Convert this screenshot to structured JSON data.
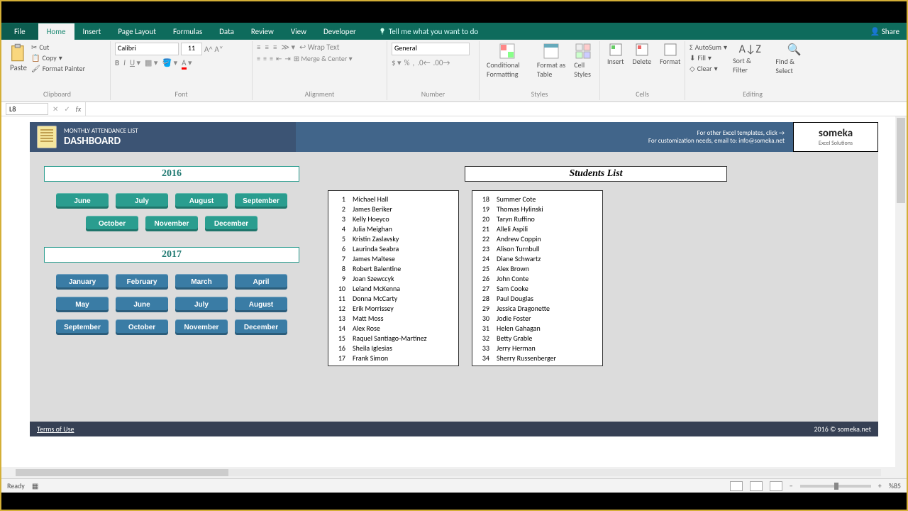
{
  "tabs": {
    "file": "File",
    "home": "Home",
    "insert": "Insert",
    "pagelayout": "Page Layout",
    "formulas": "Formulas",
    "data": "Data",
    "review": "Review",
    "view": "View",
    "developer": "Developer"
  },
  "tell": "Tell me what you want to do",
  "share": "Share",
  "ribbon": {
    "paste": "Paste",
    "cut": "Cut",
    "copy": "Copy",
    "format_painter": "Format Painter",
    "clipboard": "Clipboard",
    "font_name": "Calibri",
    "font_size": "11",
    "font": "Font",
    "wrap": "Wrap Text",
    "merge": "Merge & Center",
    "alignment": "Alignment",
    "num_format": "General",
    "number": "Number",
    "cond_fmt": "Conditional Formatting",
    "fmt_table": "Format as Table",
    "cell_styles": "Cell Styles",
    "styles": "Styles",
    "insert": "Insert",
    "delete": "Delete",
    "format": "Format",
    "cells": "Cells",
    "autosum": "AutoSum",
    "fill": "Fill",
    "clear": "Clear",
    "sort": "Sort & Filter",
    "find": "Find & Select",
    "editing": "Editing"
  },
  "namebox": "L8",
  "dashboard": {
    "title_small": "MONTHLY ATTENDANCE LIST",
    "title_big": "DASHBOARD",
    "banner1": "For other Excel templates, click →",
    "banner2": "For customization needs, email to: info@someka.net",
    "logo": "someka",
    "logo_sub": "Excel Solutions",
    "year1": "2016",
    "months1": [
      "June",
      "July",
      "August",
      "September",
      "October",
      "November",
      "December"
    ],
    "year2": "2017",
    "months2": [
      "January",
      "February",
      "March",
      "April",
      "May",
      "June",
      "July",
      "August",
      "September",
      "October",
      "November",
      "December"
    ],
    "students_label": "Students List",
    "students_col1": [
      {
        "n": "1",
        "name": "Michael Hall"
      },
      {
        "n": "2",
        "name": "James Beriker"
      },
      {
        "n": "3",
        "name": "Kelly Hoeyco"
      },
      {
        "n": "4",
        "name": "Julia Meighan"
      },
      {
        "n": "5",
        "name": "Kristin Zaslavsky"
      },
      {
        "n": "6",
        "name": "Laurinda Seabra"
      },
      {
        "n": "7",
        "name": "James Maltese"
      },
      {
        "n": "8",
        "name": "Robert Balentine"
      },
      {
        "n": "9",
        "name": "Joan Szewccyk"
      },
      {
        "n": "10",
        "name": "Leland McKenna"
      },
      {
        "n": "11",
        "name": "Donna McCarty"
      },
      {
        "n": "12",
        "name": "Erik Morrissey"
      },
      {
        "n": "13",
        "name": "Matt Moss"
      },
      {
        "n": "14",
        "name": "Alex Rose"
      },
      {
        "n": "15",
        "name": "Raquel Santiago-Martinez"
      },
      {
        "n": "16",
        "name": "Sheila Iglesias"
      },
      {
        "n": "17",
        "name": "Frank Simon"
      }
    ],
    "students_col2": [
      {
        "n": "18",
        "name": "Summer Cote"
      },
      {
        "n": "19",
        "name": "Thomas Hylinski"
      },
      {
        "n": "20",
        "name": "Taryn Ruffino"
      },
      {
        "n": "21",
        "name": "Alleli Aspili"
      },
      {
        "n": "22",
        "name": "Andrew Coppin"
      },
      {
        "n": "23",
        "name": "Alison Turnbull"
      },
      {
        "n": "24",
        "name": "Diane Schwartz"
      },
      {
        "n": "25",
        "name": "Alex Brown"
      },
      {
        "n": "26",
        "name": "John Conte"
      },
      {
        "n": "27",
        "name": "Sam Cooke"
      },
      {
        "n": "28",
        "name": "Paul Douglas"
      },
      {
        "n": "29",
        "name": "Jessica Dragonette"
      },
      {
        "n": "30",
        "name": "Jodie Foster"
      },
      {
        "n": "31",
        "name": "Helen Gahagan"
      },
      {
        "n": "32",
        "name": "Betty Grable"
      },
      {
        "n": "33",
        "name": "Jerry Herman"
      },
      {
        "n": "34",
        "name": "Sherry Russenberger"
      }
    ],
    "terms": "Terms of Use",
    "copyright": "2016 © someka.net"
  },
  "status": {
    "ready": "Ready",
    "zoom": "%85"
  }
}
